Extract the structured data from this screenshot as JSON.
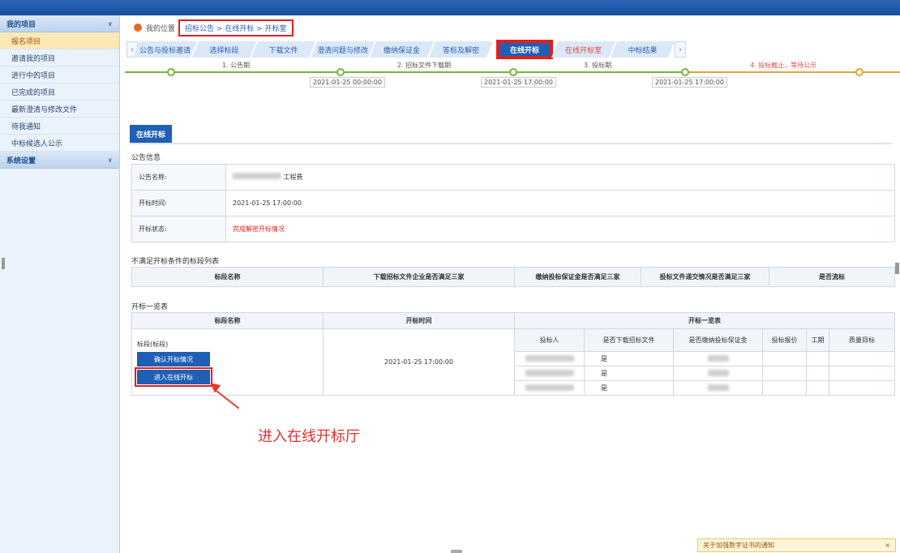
{
  "sidebar": {
    "group1": "我的项目",
    "items": [
      "报名项目",
      "邀请我的项目",
      "进行中的项目",
      "已完成的项目",
      "最新澄清与修改文件",
      "待我通知",
      "中标候选人公示"
    ],
    "group2": "系统设置"
  },
  "breadcrumb": {
    "home": "我的位置",
    "path": "招标公告 > 在线开标 > 开标室"
  },
  "tabs": [
    "公告与投标邀请",
    "选择标段",
    "下载文件",
    "澄清问题与修改",
    "缴纳保证金",
    "答标及解密",
    "在线开标",
    "在线开标室",
    "中标结果"
  ],
  "timeline": {
    "steps": [
      "1. 公告期",
      "2. 招标文件下载期",
      "3. 投标期",
      "4. 投标截止，等待公示"
    ],
    "dates": [
      "2021-01-25 00:00:00",
      "2021-01-25 17:00:00",
      "2021-01-25 17:00:00"
    ]
  },
  "panel": {
    "tab_label": "在线开标"
  },
  "announcement": {
    "title": "公告信息",
    "name_label": "公告名称:",
    "name_value": "工程费",
    "time_label": "开标时间:",
    "time_value": "2021-01-25 17:00:00",
    "status_label": "开标状态:",
    "status_value": "完成解密开标情况"
  },
  "unqualified": {
    "title": "不满足开标条件的标段列表",
    "headers": [
      "标段名称",
      "下载招标文件企业是否满足三家",
      "缴纳投标保证金是否满足三家",
      "投标文件递交情况是否满足三家",
      "是否流标"
    ]
  },
  "open_list": {
    "title": "开标一览表",
    "headers": [
      "标段名称",
      "开标时间",
      "开标一览表"
    ],
    "sub_headers": [
      "投标人",
      "是否下载招标文件",
      "是否缴纳投标保证金",
      "投标报价",
      "工期",
      "质量目标"
    ],
    "section_label": "标段(标段)",
    "confirm_button": "确认开标情况",
    "enter_button": "进入在线开标",
    "open_time": "2021-01-25 17:00:00",
    "rows": [
      {
        "downloaded": "是"
      },
      {
        "downloaded": "是"
      },
      {
        "downloaded": "是"
      }
    ]
  },
  "annotation": "进入在线开标厅",
  "notification": {
    "text": "关于加强数字证书的通知",
    "close": "×"
  }
}
